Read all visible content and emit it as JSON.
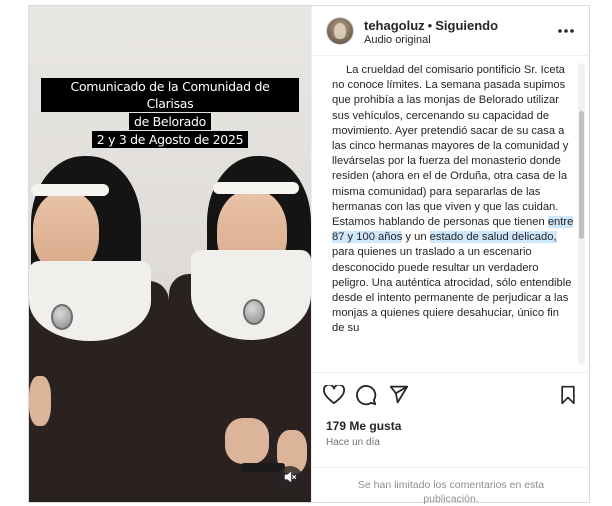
{
  "video": {
    "overlay_lines": [
      "Comunicado de la Comunidad de Clarisas",
      "de Belorado",
      "2 y 3 de Agosto de 2025"
    ],
    "mute_icon": "speaker-muted-icon"
  },
  "header": {
    "username": "tehagoluz",
    "separator": "•",
    "follow_status": "Siguiendo",
    "audio_label": "Audio original",
    "more_icon": "more-horizontal-icon"
  },
  "caption": {
    "before_highlight": "La crueldad del comisario pontificio Sr. Iceta no conoce límites. La semana pasada supimos que prohibía a las monjas de Belorado utilizar sus vehículos, cercenando su capacidad de movimiento. Ayer pretendió sacar de su casa a las cinco hermanas mayores de la comunidad y llevárselas por la fuerza del monasterio donde residen (ahora en el de Orduña, otra casa de la misma comunidad) para separarlas de las hermanas con las que viven y que las cuidan. Estamos hablando de personas que tienen ",
    "highlight_1": "entre 87 y 100 años",
    "middle": " y un ",
    "highlight_2": "estado de salud delicado,",
    "after_highlight": " para quienes un traslado a un escenario desconocido puede resultar un verdadero peligro. Una auténtica atrocidad, sólo entendible desde el intento permanente de perjudicar a las monjas a quienes quiere desahuciar, único fin de su"
  },
  "actions": {
    "like_icon": "heart-icon",
    "comment_icon": "comment-icon",
    "share_icon": "send-icon",
    "save_icon": "bookmark-icon",
    "likes": "179 Me gusta",
    "time_ago": "Hace un día",
    "comments_limited": "Se han limitado los comentarios en esta publicación."
  },
  "colors": {
    "highlight": "#cfe7fb",
    "border": "#dbdbdb",
    "secondary_text": "#737373"
  }
}
